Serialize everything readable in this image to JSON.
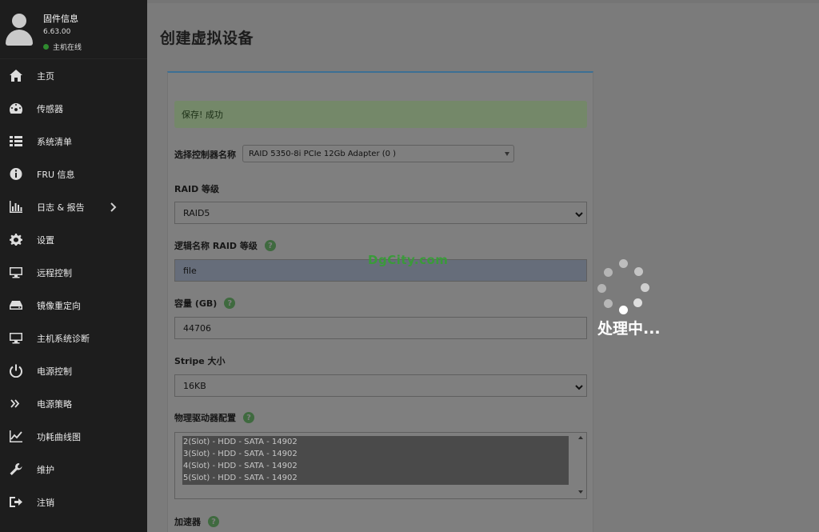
{
  "user": {
    "title": "固件信息",
    "version": "6.63.00",
    "status": "主机在线",
    "status_color": "#2f8a2f"
  },
  "sidebar": {
    "items": [
      {
        "label": "主页",
        "icon": "home-icon"
      },
      {
        "label": "传感器",
        "icon": "gauge-icon"
      },
      {
        "label": "系统清单",
        "icon": "list-icon"
      },
      {
        "label": "FRU 信息",
        "icon": "info-icon"
      },
      {
        "label": "日志 & 报告",
        "icon": "bar-chart-icon",
        "has_submenu": true
      },
      {
        "label": "设置",
        "icon": "gear-icon"
      },
      {
        "label": "远程控制",
        "icon": "monitor-icon"
      },
      {
        "label": "镜像重定向",
        "icon": "drive-icon"
      },
      {
        "label": "主机系统诊断",
        "icon": "monitor-icon"
      },
      {
        "label": "电源控制",
        "icon": "power-icon"
      },
      {
        "label": "电源策略",
        "icon": "double-chevron-icon"
      },
      {
        "label": "功耗曲线图",
        "icon": "line-chart-icon"
      },
      {
        "label": "维护",
        "icon": "wrench-icon"
      },
      {
        "label": "注销",
        "icon": "logout-icon"
      }
    ]
  },
  "page": {
    "title": "创建虚拟设备"
  },
  "form": {
    "alert": "保存! 成功",
    "controller_label": "选择控制器名称",
    "controller_value": "RAID 5350-8i PCIe 12Gb Adapter (0 )",
    "raid_level_label": "RAID 等级",
    "raid_level_value": "RAID5",
    "logical_name_label": "逻辑名称 RAID 等级",
    "logical_name_value": "file",
    "capacity_label": "容量 (GB)",
    "capacity_value": "44706",
    "stripe_label": "Stripe 大小",
    "stripe_value": "16KB",
    "drives_label": "物理驱动器配置",
    "drives": [
      "2(Slot) - HDD - SATA - 14902",
      "3(Slot) - HDD - SATA - 14902",
      "4(Slot) - HDD - SATA - 14902",
      "5(Slot) - HDD - SATA - 14902"
    ],
    "accelerator_label": "加速器",
    "help_symbol": "?"
  },
  "overlay": {
    "watermark": "DgCity.com",
    "processing": "处理中..."
  },
  "colors": {
    "sidebar_bg": "#1d1d1d",
    "panel_border_accent": "#3c6f94",
    "alert_bg": "#748869",
    "help_icon": "#3f6a3f",
    "watermark": "#3a9a3a"
  }
}
